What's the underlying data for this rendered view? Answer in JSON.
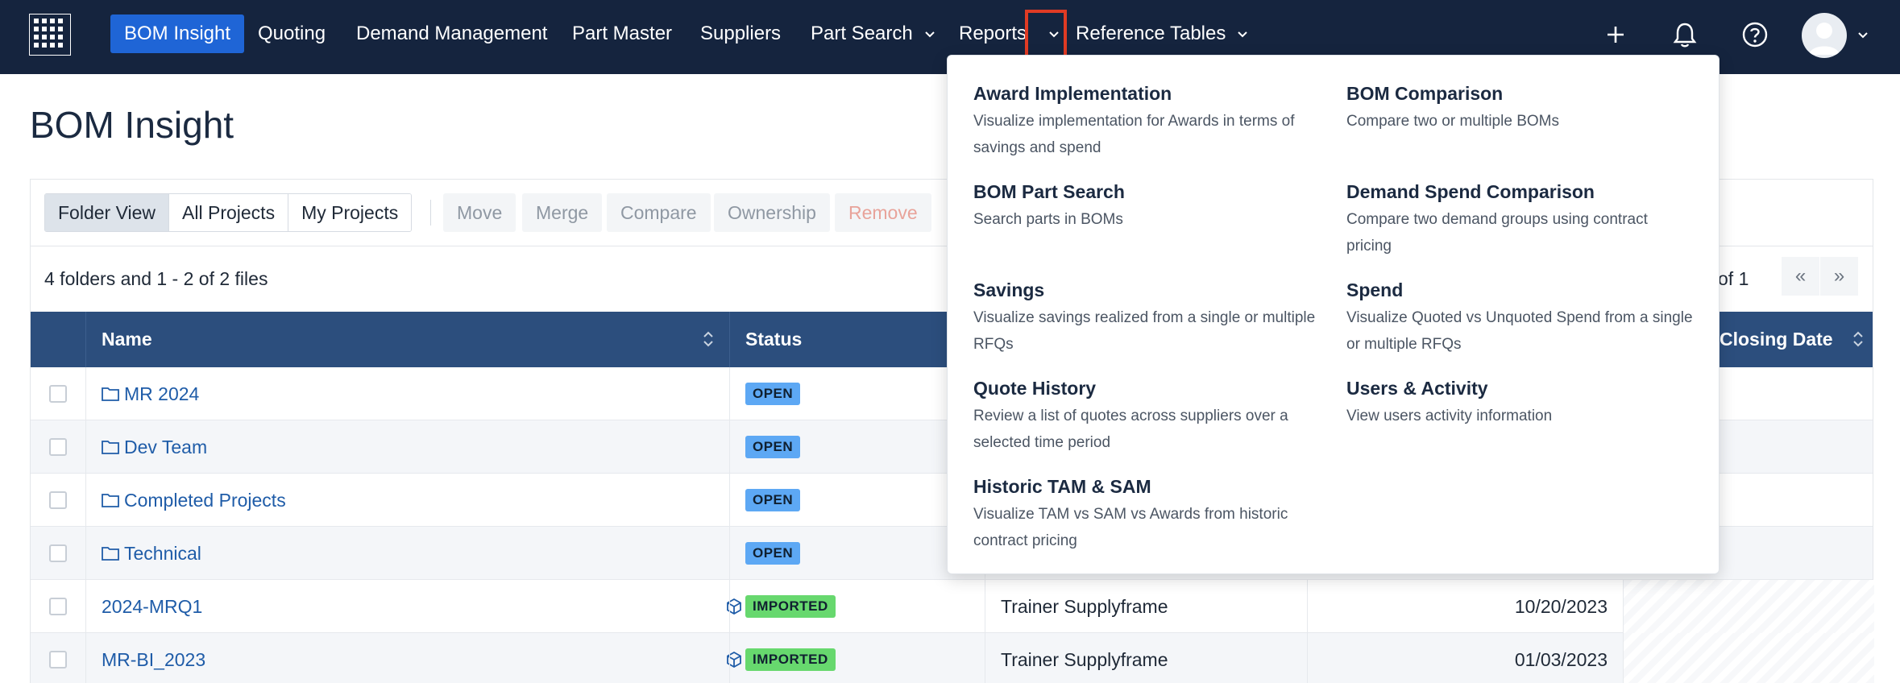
{
  "nav": {
    "logo_icon": "grid-logo-icon",
    "items": [
      {
        "label": "BOM Insight",
        "active": true
      },
      {
        "label": "Quoting"
      },
      {
        "label": "Demand Management"
      },
      {
        "label": "Part Master"
      },
      {
        "label": "Suppliers"
      },
      {
        "label": "Part Search",
        "has_dropdown": true
      },
      {
        "label": "Reports",
        "has_dropdown": true,
        "open": true
      },
      {
        "label": "Reference Tables",
        "has_dropdown": true
      }
    ],
    "icons": [
      "plus-icon",
      "bell-icon",
      "help-icon",
      "avatar"
    ],
    "colors": {
      "background": "#15243e",
      "active": "#1f65d6",
      "highlight": "#e03b24"
    }
  },
  "page": {
    "title": "BOM Insight"
  },
  "toolbar": {
    "views": [
      {
        "label": "Folder View",
        "active": true
      },
      {
        "label": "All Projects"
      },
      {
        "label": "My Projects"
      }
    ],
    "actions": [
      {
        "label": "Move"
      },
      {
        "label": "Merge"
      },
      {
        "label": "Compare"
      },
      {
        "label": "Ownership"
      },
      {
        "label": "Remove",
        "danger": true
      }
    ]
  },
  "listing": {
    "count_text": "4 folders and 1 - 2 of 2 files",
    "page_of": "of 1",
    "pager": {
      "prev": "«",
      "next": "»"
    }
  },
  "table": {
    "columns": [
      "Name",
      "Status",
      "Closing Date"
    ],
    "rows": [
      {
        "name": "MR 2024",
        "type": "folder",
        "status": "OPEN",
        "owner": "",
        "date": ""
      },
      {
        "name": "Dev Team",
        "type": "folder",
        "status": "OPEN",
        "owner": "",
        "date": ""
      },
      {
        "name": "Completed Projects",
        "type": "folder",
        "status": "OPEN",
        "owner": "",
        "date": ""
      },
      {
        "name": "Technical",
        "type": "folder",
        "status": "OPEN",
        "owner": "",
        "date": ""
      },
      {
        "name": "2024-MRQ1",
        "type": "file",
        "status": "IMPORTED",
        "owner": "Trainer Supplyframe",
        "date": "10/20/2023"
      },
      {
        "name": "MR-BI_2023",
        "type": "file",
        "status": "IMPORTED",
        "owner": "Trainer Supplyframe",
        "date": "01/03/2023"
      }
    ],
    "colors": {
      "header": "#2c4e7d",
      "open_badge": "#5da8f4",
      "imported_badge": "#67d86e",
      "link": "#1f5ca8"
    }
  },
  "reports_menu": {
    "left": [
      {
        "title": "Award Implementation",
        "desc": "Visualize implementation for Awards in terms of savings and spend"
      },
      {
        "title": "BOM Part Search",
        "desc": "Search parts in BOMs"
      },
      {
        "title": "Savings",
        "desc": "Visualize savings realized from a single or multiple RFQs"
      },
      {
        "title": "Quote History",
        "desc": "Review a list of quotes across suppliers over a selected time period"
      },
      {
        "title": "Historic TAM & SAM",
        "desc": "Visualize TAM vs SAM vs Awards from historic contract pricing"
      }
    ],
    "right": [
      {
        "title": "BOM Comparison",
        "desc": "Compare two or multiple BOMs"
      },
      {
        "title": "Demand Spend Comparison",
        "desc": "Compare two demand groups using contract pricing"
      },
      {
        "title": "Spend",
        "desc": "Visualize Quoted vs Unquoted Spend from a single or multiple RFQs"
      },
      {
        "title": "Users & Activity",
        "desc": "View users activity information"
      }
    ]
  }
}
